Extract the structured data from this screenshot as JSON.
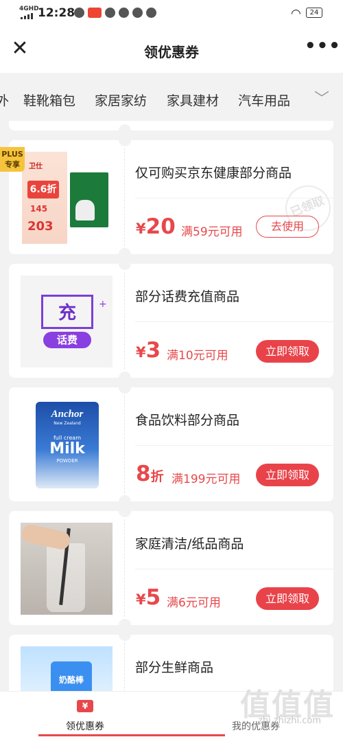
{
  "status": {
    "signal": "4GHD",
    "time": "12:28",
    "battery": "24"
  },
  "header": {
    "title": "领优惠券"
  },
  "tabs": [
    "外",
    "鞋靴箱包",
    "家居家纺",
    "家具建材",
    "汽车用品"
  ],
  "coupons": [
    {
      "name": "仅可购买京东健康部分商品",
      "amount": "20",
      "unit": "¥",
      "condition": "满59元可用",
      "action": "去使用",
      "badge": "PLUS 专享",
      "stamp": "已领取",
      "thumb_text": [
        "卫仕",
        "6.6折",
        "145",
        "203"
      ]
    },
    {
      "name": "部分话费充值商品",
      "amount": "3",
      "unit": "¥",
      "condition": "满10元可用",
      "action": "立即领取",
      "thumb_text": [
        "充",
        "话费"
      ]
    },
    {
      "name": "食品饮料部分商品",
      "amount": "8",
      "suffix": "折",
      "condition": "满199元可用",
      "action": "立即领取",
      "thumb_text": [
        "Anchor",
        "New Zealand",
        "full cream",
        "Milk",
        "POWDER"
      ]
    },
    {
      "name": "家庭清洁/纸品商品",
      "amount": "5",
      "unit": "¥",
      "condition": "满6元可用",
      "action": "立即领取"
    },
    {
      "name": "部分生鲜商品",
      "thumb_text": [
        "奶酪棒"
      ]
    }
  ],
  "bottom": {
    "tab1": "领优惠券",
    "tab2": "我的优惠券",
    "tab1_icon": "¥"
  },
  "watermark": {
    "main": "值值值",
    "url": "zhi.zhizhi.com"
  }
}
